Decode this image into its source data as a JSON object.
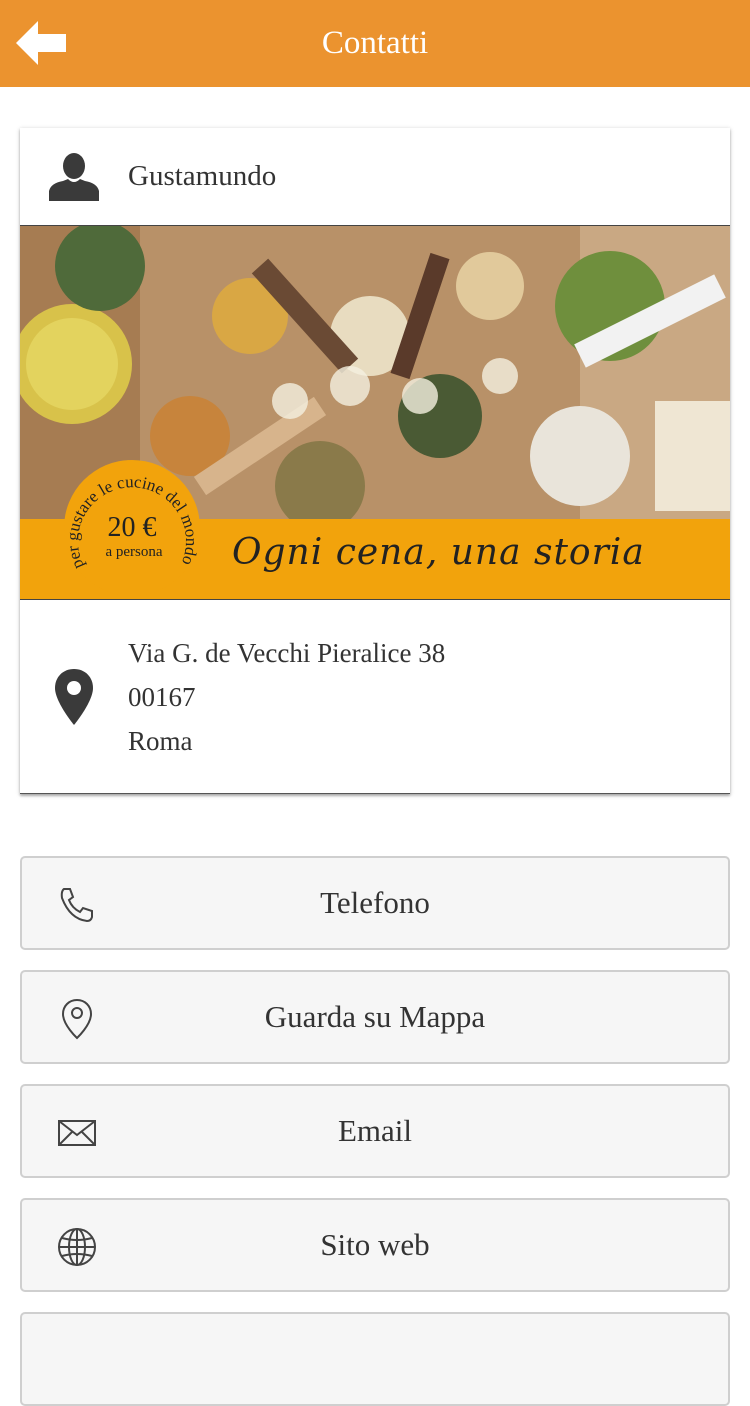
{
  "header": {
    "title": "Contatti",
    "back_icon": "arrow-left-icon",
    "bg_color": "#eb932f"
  },
  "contact": {
    "name": "Gustamundo",
    "banner": {
      "slogan": "Ogni cena, una storia",
      "badge_price": "20 €",
      "badge_sub": "a persona",
      "badge_ring_text": "per gustare le cucine del mondo"
    },
    "address": {
      "street": "Via G. de Vecchi Pieralice 38",
      "zip": "00167",
      "city": "Roma"
    }
  },
  "actions": [
    {
      "label": "Telefono",
      "icon": "phone-icon"
    },
    {
      "label": "Guarda su Mappa",
      "icon": "map-pin-icon"
    },
    {
      "label": "Email",
      "icon": "envelope-icon"
    },
    {
      "label": "Sito web",
      "icon": "globe-icon"
    }
  ]
}
